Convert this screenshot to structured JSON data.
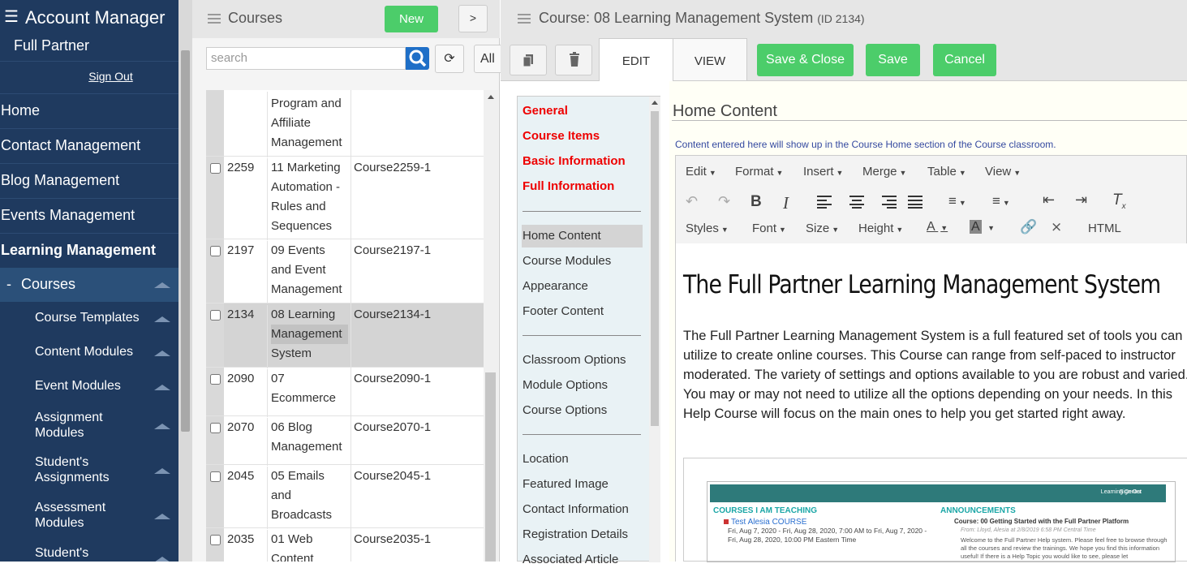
{
  "sidebar": {
    "title": "Account Manager",
    "user": "Full Partner",
    "sign_out": "Sign Out",
    "nav": [
      "Home",
      "Contact Management",
      "Blog Management",
      "Events Management",
      "Learning Management"
    ],
    "active": "Courses",
    "active_prefix": "-",
    "subs": [
      "Course Templates",
      "Content Modules",
      "Event Modules",
      "Assignment Modules",
      "Student's Assignments",
      "Assessment Modules",
      "Student's"
    ]
  },
  "courses": {
    "title": "Courses",
    "new_label": "New",
    "gt_label": ">",
    "search_placeholder": "search",
    "all_label": "All",
    "rows": [
      {
        "id": "",
        "name": [
          "Program and",
          "Affiliate",
          "Management"
        ],
        "code": ""
      },
      {
        "id": "2259",
        "name": [
          "11 Marketing",
          "Automation -",
          "Rules and",
          "Sequences"
        ],
        "code": "Course2259-1"
      },
      {
        "id": "2197",
        "name": [
          "09 Events",
          "and Event",
          "Management"
        ],
        "code": "Course2197-1"
      },
      {
        "id": "2134",
        "name": [
          "08 Learning",
          "Management",
          "System"
        ],
        "code": "Course2134-1"
      },
      {
        "id": "2090",
        "name": [
          "07",
          "Ecommerce"
        ],
        "code": "Course2090-1"
      },
      {
        "id": "2070",
        "name": [
          "06 Blog",
          "Management"
        ],
        "code": "Course2070-1"
      },
      {
        "id": "2045",
        "name": [
          "05 Emails",
          "and",
          "Broadcasts"
        ],
        "code": "Course2045-1"
      },
      {
        "id": "2035",
        "name": [
          "01 Web",
          "Content"
        ],
        "code": "Course2035-1"
      }
    ]
  },
  "editor": {
    "title": "Course: 08 Learning Management System",
    "id_label": "(ID 2134)",
    "tabs": [
      "EDIT",
      "VIEW"
    ],
    "save_close": "Save & Close",
    "save": "Save",
    "cancel": "Cancel",
    "nav_red": [
      "General",
      "Course Items",
      "Basic Information",
      "Full Information"
    ],
    "nav_g1": [
      "Home Content",
      "Course Modules",
      "Appearance",
      "Footer Content"
    ],
    "nav_g2": [
      "Classroom Options",
      "Module Options",
      "Course Options"
    ],
    "nav_g3": [
      "Location",
      "Featured Image",
      "Contact Information",
      "Registration Details",
      "Associated Article"
    ],
    "section_title": "Home Content",
    "section_desc": "Content entered here will show up in the Course Home section of the Course classroom.",
    "menus": [
      "Edit",
      "Format",
      "Insert",
      "Merge",
      "Table",
      "View"
    ],
    "toolbar2": [
      "Styles",
      "Font",
      "Size",
      "Height"
    ],
    "html_label": "HTML",
    "doc_heading": "The Full Partner Learning Management System",
    "doc_paragraph": "The Full Partner Learning Management System is a full featured set of tools you can utilize to create online courses. This Course can range from self-paced to instructor moderated. The variety of settings and options available to you are robust and varied. You may or may not need to utilize all the options depending on your needs. In this Help Course will focus on the main ones to help you get started right away.",
    "shot": {
      "bar_title": "Learning Center",
      "bar_right": "Sign Out",
      "teaching": "COURSES I AM TEACHING",
      "announce": "ANNOUNCEMENTS",
      "course": "Test Alesia COURSE",
      "dates": "Fri, Aug 7, 2020 - Fri, Aug 28, 2020, 7:00 AM to Fri, Aug 7, 2020 - Fri, Aug 28, 2020, 10:00 PM Eastern Time",
      "ann_title": "Course: 00 Getting Started with the Full Partner Platform",
      "ann_from": "From: Lloyd, Alesia at 2/8/2019 6:58 PM Central Time",
      "ann_text": "Welcome to the Full Partner Help system. Please feel free to browse through all the courses and review the trainings. We hope you find this information useful! If there is a Help Topic you would like to see, please let"
    }
  },
  "colors": {
    "sidebar": "#1f3a5f",
    "sidebar_active": "#2b5079",
    "green": "#4ccd6a",
    "red": "#e00000",
    "search_blue": "#1f6fc7"
  }
}
